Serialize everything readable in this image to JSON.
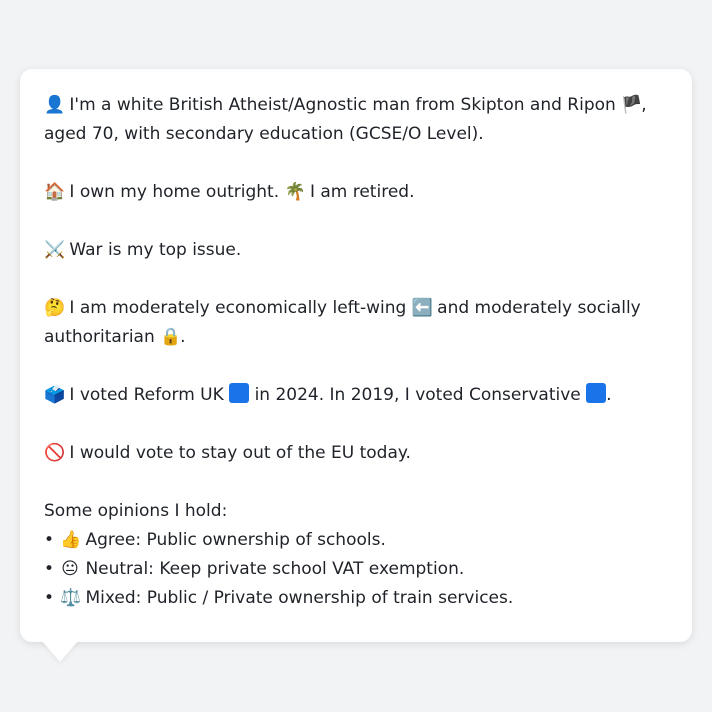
{
  "profile": {
    "intro": {
      "icon": "person-silhouette-icon",
      "icon_glyph": "👤",
      "text_a": "I'm a white British Atheist/Agnostic man from Skipton and Ripon",
      "flag_icon": "england-flag-icon",
      "flag_glyph": "🏴",
      "text_b": ", aged 70, with secondary education (GCSE/O Level)."
    },
    "home": {
      "icon": "house-icon",
      "icon_glyph": "🏠",
      "text_a": "I own my home outright.",
      "icon2": "palm-tree-icon",
      "icon2_glyph": "🌴",
      "text_b": "I am retired."
    },
    "issue": {
      "icon": "crossed-swords-icon",
      "icon_glyph": "⚔️",
      "text": "War is my top issue."
    },
    "ideology": {
      "icon": "thinking-face-icon",
      "icon_glyph": "🤔",
      "text_a": "I am moderately economically left-wing",
      "arrow_icon": "left-arrow-icon",
      "arrow_glyph": "⬅️",
      "text_b": "and moderately socially authoritarian",
      "lock_icon": "lock-icon",
      "lock_glyph": "🔒",
      "text_c": "."
    },
    "vote": {
      "icon": "ballot-box-icon",
      "icon_glyph": "🗳️",
      "text_a": "I voted Reform UK",
      "reform_color": "#1a73e8",
      "text_b": "in 2024. In 2019, I voted Conservative",
      "conservative_color": "#1a73e8",
      "text_c": "."
    },
    "eu": {
      "icon": "prohibited-icon",
      "icon_glyph": "🚫",
      "text": "I would vote to stay out of the EU today."
    }
  },
  "opinions": {
    "heading": "Some opinions I hold:",
    "bullet": "•",
    "items": [
      {
        "icon": "thumbs-up-icon",
        "glyph": "👍",
        "text": "Agree: Public ownership of schools."
      },
      {
        "icon": "neutral-face-icon",
        "glyph": "😐",
        "text": "Neutral: Keep private school VAT exemption."
      },
      {
        "icon": "balance-scale-icon",
        "glyph": "⚖️",
        "text": "Mixed: Public / Private ownership of train services."
      }
    ]
  }
}
